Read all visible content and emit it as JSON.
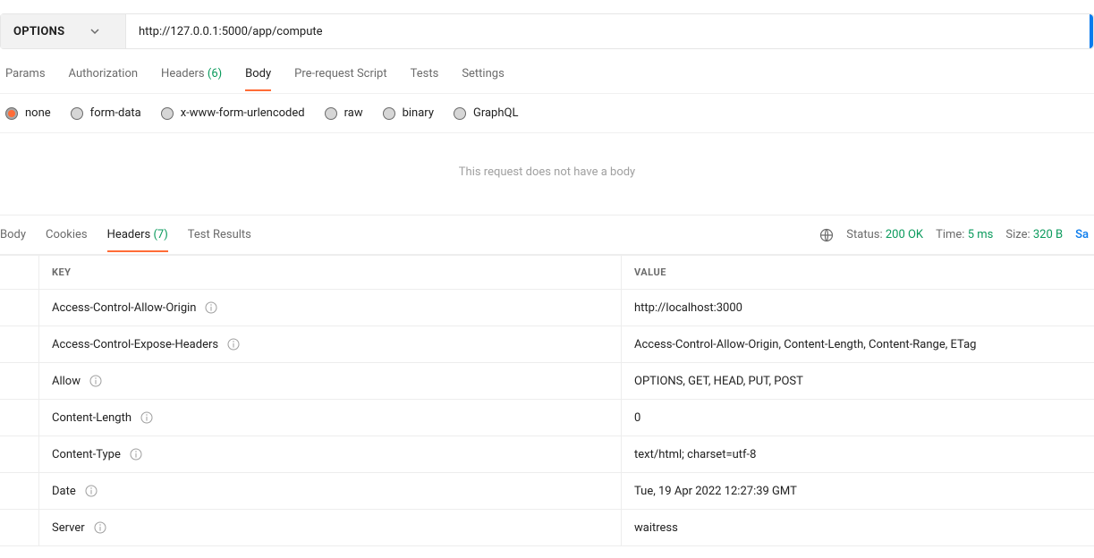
{
  "request": {
    "method": "OPTIONS",
    "url": "http://127.0.0.1:5000/app/compute"
  },
  "requestTabs": {
    "items": [
      {
        "label": "Params",
        "active": false,
        "count": null
      },
      {
        "label": "Authorization",
        "active": false,
        "count": null
      },
      {
        "label": "Headers",
        "active": false,
        "count": "(6)"
      },
      {
        "label": "Body",
        "active": true,
        "count": null
      },
      {
        "label": "Pre-request Script",
        "active": false,
        "count": null
      },
      {
        "label": "Tests",
        "active": false,
        "count": null
      },
      {
        "label": "Settings",
        "active": false,
        "count": null
      }
    ]
  },
  "bodyTypes": {
    "items": [
      {
        "label": "none",
        "selected": true
      },
      {
        "label": "form-data",
        "selected": false
      },
      {
        "label": "x-www-form-urlencoded",
        "selected": false
      },
      {
        "label": "raw",
        "selected": false
      },
      {
        "label": "binary",
        "selected": false
      },
      {
        "label": "GraphQL",
        "selected": false
      }
    ]
  },
  "bodyEmptyMessage": "This request does not have a body",
  "responseTabs": {
    "items": [
      {
        "label": "Body",
        "active": false,
        "count": null
      },
      {
        "label": "Cookies",
        "active": false,
        "count": null
      },
      {
        "label": "Headers",
        "active": true,
        "count": "(7)"
      },
      {
        "label": "Test Results",
        "active": false,
        "count": null
      }
    ]
  },
  "responseMeta": {
    "status_label": "Status:",
    "status_value": "200 OK",
    "time_label": "Time:",
    "time_value": "5 ms",
    "size_label": "Size:",
    "size_value": "320 B",
    "save_label": "Sa"
  },
  "responseHeadersTable": {
    "keyHeader": "KEY",
    "valueHeader": "VALUE",
    "rows": [
      {
        "key": "Access-Control-Allow-Origin",
        "value": "http://localhost:3000"
      },
      {
        "key": "Access-Control-Expose-Headers",
        "value": "Access-Control-Allow-Origin, Content-Length, Content-Range, ETag"
      },
      {
        "key": "Allow",
        "value": "OPTIONS, GET, HEAD, PUT, POST"
      },
      {
        "key": "Content-Length",
        "value": "0"
      },
      {
        "key": "Content-Type",
        "value": "text/html; charset=utf-8"
      },
      {
        "key": "Date",
        "value": "Tue, 19 Apr 2022 12:27:39 GMT"
      },
      {
        "key": "Server",
        "value": "waitress"
      }
    ]
  }
}
